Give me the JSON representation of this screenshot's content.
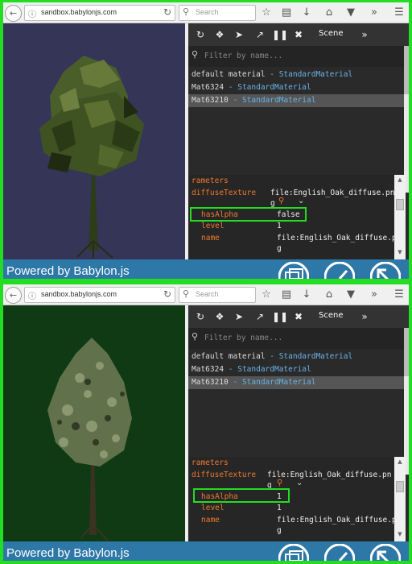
{
  "panels": [
    {
      "browser": {
        "back_icon": "back-arrow-icon",
        "url": "sandbox.babylonjs.com",
        "search_placeholder": "Search",
        "toolbar_icons": [
          "star-icon",
          "clipboard-icon",
          "download-icon",
          "home-icon",
          "pocket-icon",
          "overflow-icon",
          "menu-icon"
        ]
      },
      "inspector": {
        "tab_label": "Scene",
        "filter_placeholder": "Filter by name...",
        "materials": [
          {
            "name": "default material",
            "sep": " - ",
            "type": "StandardMaterial",
            "selected": false
          },
          {
            "name": "Mat6324",
            "sep": " - ",
            "type": "StandardMaterial",
            "selected": false
          },
          {
            "name": "Mat63210",
            "sep": " - ",
            "type": "StandardMaterial",
            "selected": true
          }
        ],
        "params_header": "rameters",
        "props": {
          "diffuse_key": "diffuseTexture",
          "diffuse_val_1": "file:English_Oak_diffuse.pn",
          "diffuse_val_2": "g",
          "hasalpha_key": "hasAlpha",
          "hasalpha_val": "false",
          "level_key": "level",
          "level_val": "1",
          "name_key": "name",
          "name_val_1": "file:English_Oak_diffuse.pn",
          "name_val_2": "g"
        }
      },
      "banner": "Powered by Babylon.js"
    },
    {
      "browser": {
        "back_icon": "back-arrow-icon",
        "url": "sandbox.babylonjs.com",
        "search_placeholder": "Search",
        "toolbar_icons": [
          "star-icon",
          "clipboard-icon",
          "download-icon",
          "home-icon",
          "pocket-icon",
          "overflow-icon",
          "menu-icon"
        ]
      },
      "inspector": {
        "tab_label": "Scene",
        "filter_placeholder": "Filter by name...",
        "materials": [
          {
            "name": "default material",
            "sep": " - ",
            "type": "StandardMaterial",
            "selected": false
          },
          {
            "name": "Mat6324",
            "sep": " - ",
            "type": "StandardMaterial",
            "selected": false
          },
          {
            "name": "Mat63210",
            "sep": " - ",
            "type": "StandardMaterial",
            "selected": true
          }
        ],
        "params_header": "rameters",
        "props": {
          "diffuse_key": "diffuseTexture",
          "diffuse_val_1": "file:English_Oak_diffuse.pn",
          "diffuse_val_2": "g",
          "hasalpha_key": "hasAlpha",
          "hasalpha_val": "1",
          "level_key": "level",
          "level_val": "1",
          "name_key": "name",
          "name_val_1": "file:English_Oak_diffuse.pn",
          "name_val_2": "g"
        }
      },
      "banner": "Powered by Babylon.js"
    }
  ],
  "colors": {
    "highlight": "#22dd22",
    "property_key": "#f0782f",
    "material_type": "#6ab2e6",
    "banner": "#2e78a8",
    "viewport": "#353558"
  }
}
